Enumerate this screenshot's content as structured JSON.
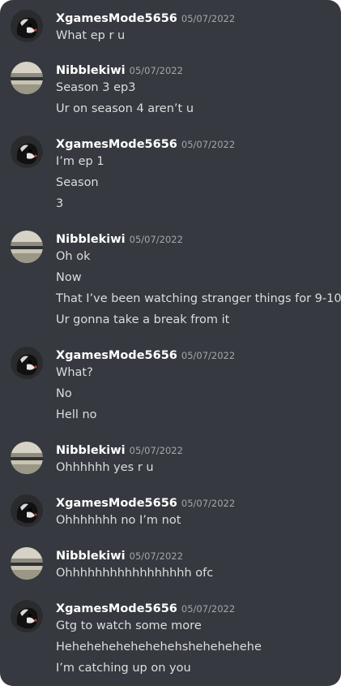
{
  "users": {
    "x": {
      "name": "XgamesMode5656",
      "avatar_icon": "dog-avatar-icon"
    },
    "n": {
      "name": "Nibblekiwi",
      "avatar_icon": "sunset-lake-avatar-icon"
    }
  },
  "messages": [
    {
      "author": "XgamesMode5656",
      "timestamp": "05/07/2022",
      "lines": [
        "What ep r u"
      ]
    },
    {
      "author": "Nibblekiwi",
      "timestamp": "05/07/2022",
      "lines": [
        "Season 3 ep3",
        "Ur on season 4 aren’t u"
      ]
    },
    {
      "author": "XgamesMode5656",
      "timestamp": "05/07/2022",
      "lines": [
        "I’m ep 1",
        "Season",
        "3"
      ]
    },
    {
      "author": "Nibblekiwi",
      "timestamp": "05/07/2022",
      "lines": [
        "Oh ok",
        "Now",
        "That I’ve been watching stranger things for 9-10",
        "Ur gonna take a break from it"
      ]
    },
    {
      "author": "XgamesMode5656",
      "timestamp": "05/07/2022",
      "lines": [
        "What?",
        "No",
        "Hell no"
      ]
    },
    {
      "author": "Nibblekiwi",
      "timestamp": "05/07/2022",
      "lines": [
        "Ohhhhhh yes r u"
      ]
    },
    {
      "author": "XgamesMode5656",
      "timestamp": "05/07/2022",
      "lines": [
        "Ohhhhhhh no I’m not"
      ]
    },
    {
      "author": "Nibblekiwi",
      "timestamp": "05/07/2022",
      "lines": [
        "Ohhhhhhhhhhhhhhhhh ofc"
      ]
    },
    {
      "author": "XgamesMode5656",
      "timestamp": "05/07/2022",
      "lines": [
        "Gtg to watch some more",
        "Hehehehehehehehehshehehehehe",
        "I’m catching up on you"
      ]
    }
  ],
  "colors": {
    "background": "#36393f",
    "username": "#ffffff",
    "timestamp": "#a3a6aa",
    "message_text": "#dcddde"
  }
}
